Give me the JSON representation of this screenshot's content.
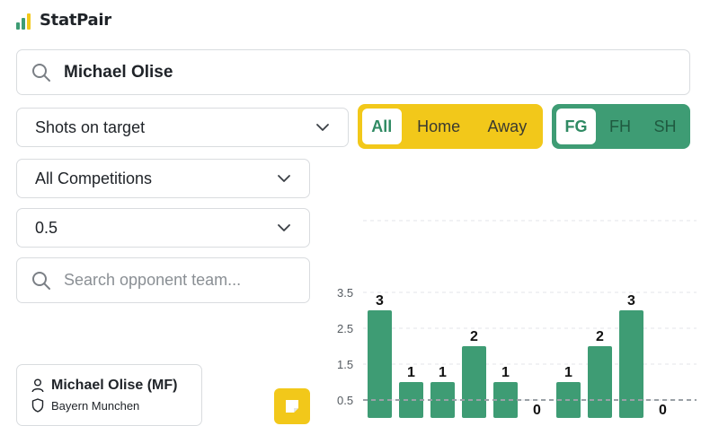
{
  "app": {
    "name": "StatPair"
  },
  "search": {
    "value": "Michael Olise"
  },
  "market_select": {
    "value": "Shots on target"
  },
  "competition_select": {
    "value": "All Competitions"
  },
  "line_select": {
    "value": "0.5"
  },
  "opponent_search": {
    "placeholder": "Search opponent team..."
  },
  "venue_toggle": {
    "options": [
      "All",
      "Home",
      "Away"
    ],
    "selected": "All"
  },
  "half_toggle": {
    "options": [
      "FG",
      "FH",
      "SH"
    ],
    "selected": "FG"
  },
  "player": {
    "name": "Michael Olise (MF)",
    "team": "Bayern Munchen"
  },
  "colors": {
    "accent_green": "#3e9c74",
    "accent_yellow": "#f2c81a"
  },
  "chart_data": {
    "type": "bar",
    "values": [
      3,
      1,
      1,
      2,
      1,
      0,
      1,
      2,
      3,
      0
    ],
    "ytick_labels": [
      "3.5",
      "2.5",
      "1.5",
      "0.5"
    ],
    "yticks": [
      3.5,
      2.5,
      1.5,
      0.5
    ],
    "ylim": [
      0,
      5.5
    ],
    "threshold": 0.5,
    "bar_color": "#3e9c74",
    "grid": true
  }
}
